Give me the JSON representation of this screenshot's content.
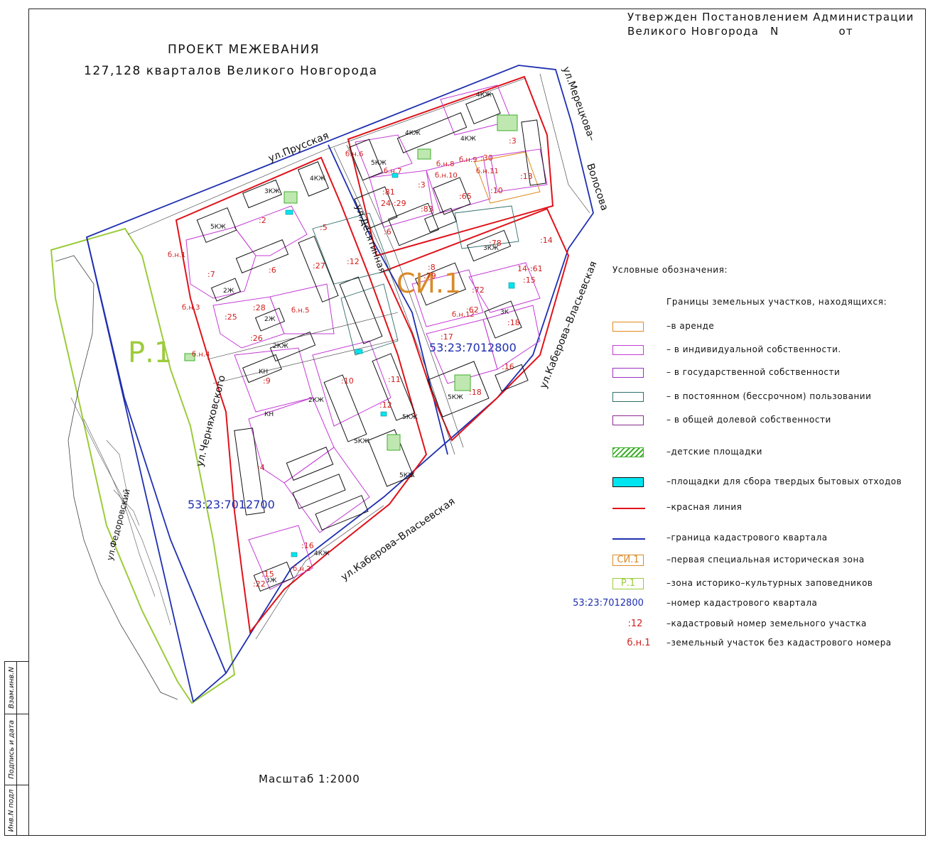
{
  "approval": {
    "line1": "Утвержден Постановлением Администрации",
    "line2_city": "Великого Новгорода",
    "line2_n": "N",
    "line2_from": "от"
  },
  "title": {
    "line1": "ПРОЕКТ МЕЖЕВАНИЯ",
    "line2": "127,128 кварталов Великого Новгорода"
  },
  "scale": "Масштаб 1:2000",
  "stamp": {
    "cell1": "Взам.инв.N",
    "cell2": "Подпись и дата",
    "cell3": "Инв.N подл"
  },
  "streets": {
    "prusskaya": "ул.Прусская",
    "meretskova": "ул.Мерецкова–",
    "volosova": "Волосова",
    "kaberova_east": "ул.Каберова–Власьевская",
    "kaberova_south": "ул.Каберова–Власьевская",
    "desyatinnaya": "ул.Десятинная",
    "chernyakhovskogo": "ул.Черняховского",
    "fedorovsky": "ул.Федоровский"
  },
  "zones": {
    "r1": "Р.1",
    "si1": "СИ.1",
    "cad_west": "53:23:7012700",
    "cad_east": "53:23:7012800"
  },
  "map_labels": [
    {
      "t": ":7"
    },
    {
      "t": ":6"
    },
    {
      "t": ":2"
    },
    {
      "t": ":25"
    },
    {
      "t": ":28"
    },
    {
      "t": ":26"
    },
    {
      "t": ":27"
    },
    {
      "t": ":9"
    },
    {
      "t": ":10"
    },
    {
      "t": ":11"
    },
    {
      "t": ":12"
    },
    {
      "t": ":16"
    },
    {
      "t": ":15"
    },
    {
      "t": ":22"
    },
    {
      "t": ":4"
    },
    {
      "t": ":81"
    },
    {
      "t": "24-:29"
    },
    {
      "t": ":83"
    },
    {
      "t": ":3"
    },
    {
      "t": ":30"
    },
    {
      "t": ":13"
    },
    {
      "t": ":10"
    },
    {
      "t": ":65"
    },
    {
      "t": ":8"
    },
    {
      "t": ":15"
    },
    {
      "t": ":17"
    },
    {
      "t": ":18"
    },
    {
      "t": ":14"
    },
    {
      "t": ":78"
    },
    {
      "t": ":72"
    },
    {
      "t": ":62"
    },
    {
      "t": ":6"
    },
    {
      "t": "14-:61"
    },
    {
      "t": ":18"
    },
    {
      "t": ":16"
    },
    {
      "t": ":79"
    },
    {
      "t": ":3"
    },
    {
      "t": ":12"
    },
    {
      "t": ":5"
    }
  ],
  "parcel_tags": [
    {
      "t": "б.н.1"
    },
    {
      "t": "б.н.3"
    },
    {
      "t": "б.н.4"
    },
    {
      "t": "б.н.5"
    },
    {
      "t": "б.н.7"
    },
    {
      "t": "б.н.8"
    },
    {
      "t": "б.н.9"
    },
    {
      "t": "б.н.10"
    },
    {
      "t": "б.н.11"
    },
    {
      "t": "б.н.12"
    },
    {
      "t": "б.н.2"
    },
    {
      "t": "б.н.6"
    }
  ],
  "building_tags": [
    {
      "t": "5КЖ"
    },
    {
      "t": "3КЖ"
    },
    {
      "t": "4КЖ"
    },
    {
      "t": "2Ж"
    },
    {
      "t": "2КЖ"
    },
    {
      "t": "2КЖ"
    },
    {
      "t": "КН"
    },
    {
      "t": "5КЖ"
    },
    {
      "t": "5КЖ"
    },
    {
      "t": "5КЖ"
    },
    {
      "t": "4КЖ"
    },
    {
      "t": "4КЖ"
    },
    {
      "t": "5КЖ"
    },
    {
      "t": "3КЖ"
    },
    {
      "t": "3К"
    },
    {
      "t": "5КЖ"
    },
    {
      "t": "2Ж"
    },
    {
      "t": "4КЖ"
    },
    {
      "t": "4КЖ"
    },
    {
      "t": "КН"
    },
    {
      "t": "3Ж"
    }
  ],
  "legend": {
    "heading": "Условные обозначения:",
    "subheading": "Границы земельных участков, находящихся:",
    "items": [
      {
        "text": "–в аренде",
        "color": "#e08a1e"
      },
      {
        "text": "– в индивидуальной собственности.",
        "color": "#c43ad6"
      },
      {
        "text": "– в государственной собственности",
        "color": "#9a2fbf"
      },
      {
        "text": "– в постоянном (бессрочном) пользовании",
        "color": "#2f6f6a"
      },
      {
        "text": "– в общей долевой собственности",
        "color": "#8c2a8c"
      },
      {
        "text": "–детские площадки",
        "color": "#3fae2c"
      },
      {
        "text": "–площадки для сбора твердых бытовых отходов",
        "color": "#00e5f0"
      },
      {
        "text": "–красная линия",
        "color": "#e0121a"
      },
      {
        "text": "–граница кадастрового квартала",
        "color": "#1e2fb0"
      },
      {
        "text": "–первая специальная историческая зона",
        "code": "СИ.1",
        "color": "#d98b2a"
      },
      {
        "text": "–зона историко–культурных заповедников",
        "code": "Р.1",
        "color": "#9ccb3a"
      },
      {
        "text": "–номер кадастрового квартала",
        "code": "53:23:7012800",
        "color": "#1e2fb0"
      },
      {
        "text": "–кадастровый номер земельного участка",
        "code": ":12",
        "color": "#d11d1d"
      },
      {
        "text": "–земельный участок без кадастрового номера",
        "code": "б.н.1",
        "color": "#d11d1d"
      }
    ]
  }
}
